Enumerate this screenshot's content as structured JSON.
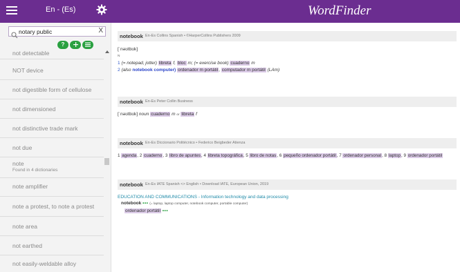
{
  "header": {
    "lang": "En - (Es)",
    "app_title": "WordFinder"
  },
  "search": {
    "value": "notary public",
    "clear_label": "X"
  },
  "pills": [
    "?",
    "+",
    "="
  ],
  "list": [
    {
      "label": "not detectable"
    },
    {
      "label": "NOT device"
    },
    {
      "label": "not digestible form of cellulose"
    },
    {
      "label": "not dimensioned"
    },
    {
      "label": "not distinctive trade mark"
    },
    {
      "label": "not due"
    },
    {
      "label": "note",
      "sub": "Found in 4 dictionaries"
    },
    {
      "label": "note amplifier"
    },
    {
      "label": "note a protest, to note a protest"
    },
    {
      "label": "note area"
    },
    {
      "label": "not earthed"
    },
    {
      "label": "not easily-weldable alloy"
    }
  ],
  "entries": {
    "collins": {
      "word": "notebook",
      "source": "En-Es Collins Spanish • ©HarperCollins Publishers 2009",
      "pron": "[ˈnəʊtbʊk]",
      "pos": "N",
      "s1_num": "1",
      "s1_a": "(= notepad, jotter)",
      "s1_b": "libreta",
      "s1_c": "f,",
      "s1_d": "bloc",
      "s1_e": "m; (= exercise book)",
      "s1_f": "cuaderno",
      "s1_g": "m",
      "s2_num": "2",
      "s2_a": "(also",
      "s2_b": "notebook computer)",
      "s2_c": "ordenador m portátil",
      "s2_d": ",",
      "s2_e": "computador m portátil",
      "s2_f": "(LAm)"
    },
    "collin": {
      "word": "notebook",
      "source": "En-Es Peter Collin Business",
      "pron": "[ˈnəʊtbʊk]",
      "pos": "noun",
      "t1": "cuaderno",
      "g1": "m",
      "or": "or",
      "t2": "libreta",
      "g2": "f"
    },
    "politecnico": {
      "word": "notebook",
      "source": "En-Es Diccionario Politécnico • Federico Beigbeder Atienza",
      "items": [
        {
          "n": "1",
          "t": "agenda"
        },
        {
          "n": "2",
          "t": "cuaderno"
        },
        {
          "n": "3",
          "t": "libro de apuntes"
        },
        {
          "n": "4",
          "t": "libreta topográfica"
        },
        {
          "n": "5",
          "t": "libro de notas"
        },
        {
          "n": "6",
          "t": "pequeño ordenador portátil"
        },
        {
          "n": "7",
          "t": "ordenador personal"
        },
        {
          "n": "8",
          "t": "laptop"
        },
        {
          "n": "9",
          "t": "ordenador portátil"
        }
      ]
    },
    "iate": {
      "word": "notebook",
      "source": "En-Es IATE Spanish <> English • Download IATE, European Union, 2019",
      "domain": "EDUCATION AND COMMUNICATIONS - Information technology and data processing",
      "term": "notebook",
      "dots": "•••",
      "syn": "(= laptop, laptop computer, notebook computer, portable computer)",
      "trans": "ordenador portátil",
      "trans_dots": "•••"
    }
  }
}
